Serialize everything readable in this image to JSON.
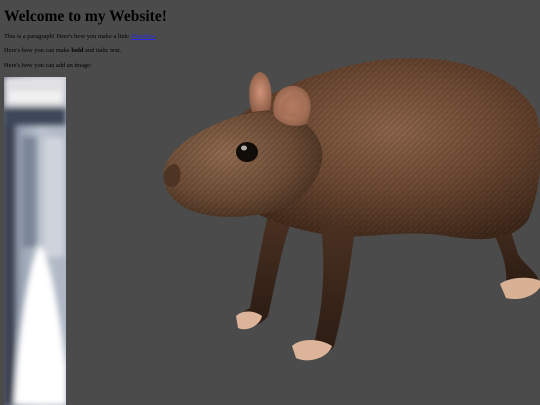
{
  "page": {
    "heading": "Welcome to my Website!",
    "paragraph1": {
      "text_before": "This is a paragraph! Here's how you make a link: ",
      "link_text": "Neocities",
      "text_after": "."
    },
    "paragraph2": {
      "text_before": "Here's how you can make ",
      "bold_text": "bold",
      "text_after": " and italic text."
    },
    "paragraph3": {
      "text": "Here's how you can add an image:"
    }
  },
  "colors": {
    "background": "#4b4b4b",
    "link": "#2a2aee",
    "rat_fur": "#6e4a34",
    "rat_ear": "#c08468",
    "rat_paw": "#dcb49a"
  },
  "icons": {
    "rat": "3d-rat-model",
    "image": "blurred-photo"
  }
}
